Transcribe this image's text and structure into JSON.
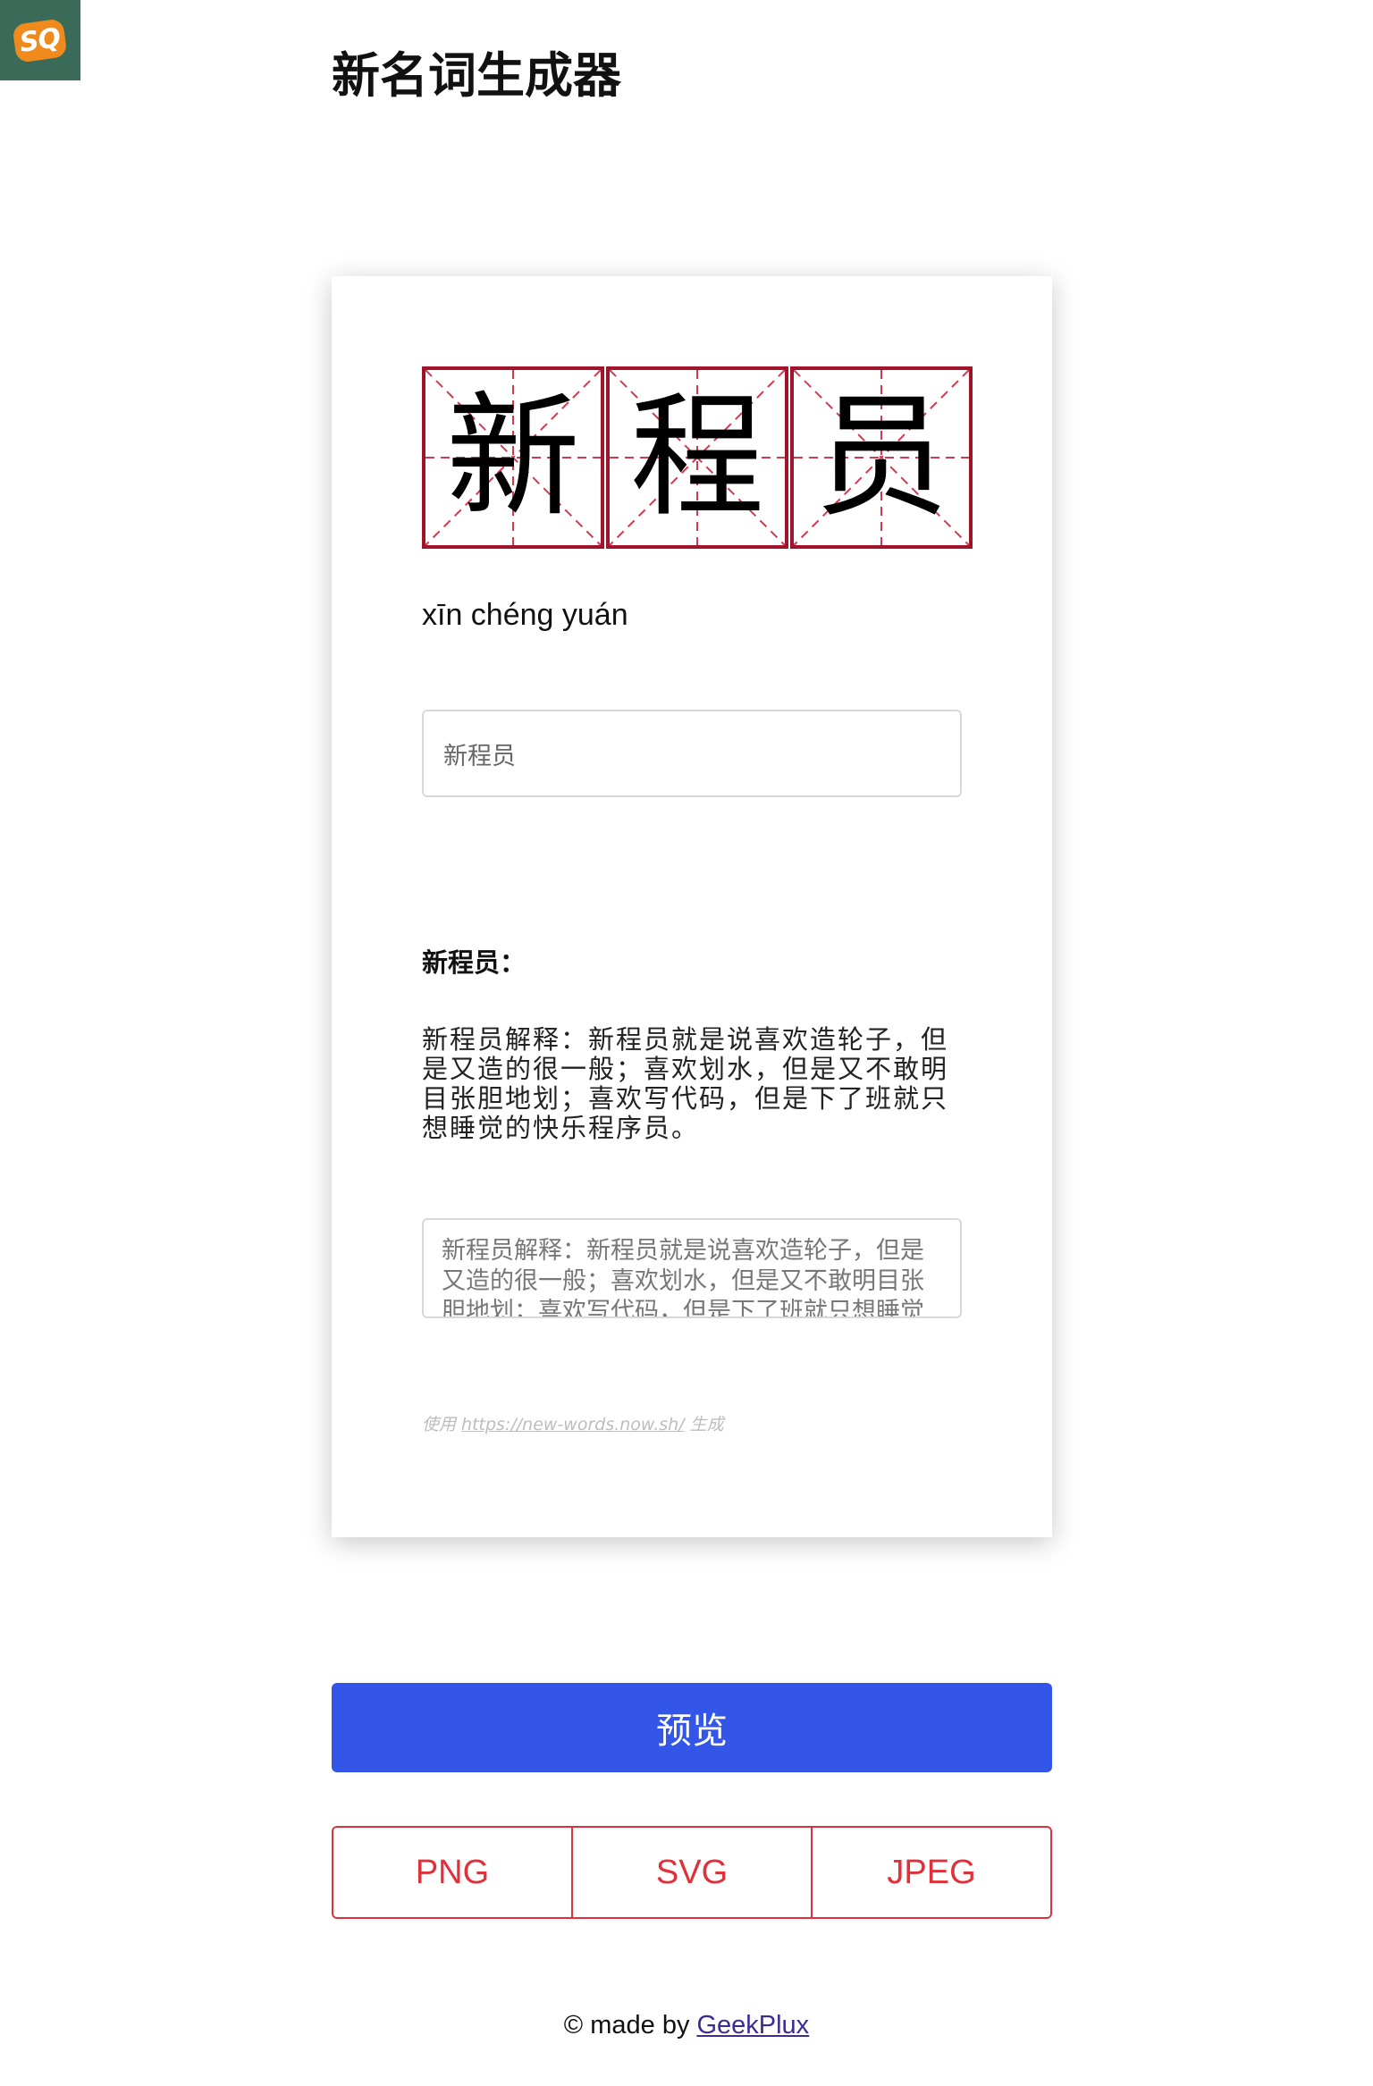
{
  "logo": {
    "text": "SQ",
    "icon": "sq-logo-icon"
  },
  "header": {
    "title": "新名词生成器"
  },
  "card": {
    "characters": [
      "新",
      "程",
      "员"
    ],
    "pinyin": "xīn chéng yuán",
    "word_input": {
      "value": "新程员"
    },
    "definition_heading": "新程员：",
    "definition_body": "新程员解释：新程员就是说喜欢造轮子，但是又造的很一般；喜欢划水，但是又不敢明目张胆地划；喜欢写代码，但是下了班就只想睡觉的快乐程序员。",
    "definition_textarea": {
      "value": "新程员解释：新程员就是说喜欢造轮子，但是又造的很一般；喜欢划水，但是又不敢明目张胆地划；喜欢写代码，但是下了班就只想睡觉的快乐程序员。"
    },
    "credit": {
      "prefix": "使用 ",
      "link": "https://new-words.now.sh/",
      "suffix": " 生成"
    }
  },
  "actions": {
    "preview_label": "预览",
    "exports": [
      "PNG",
      "SVG",
      "JPEG"
    ]
  },
  "footer": {
    "prefix": "© made by",
    "link": "GeekPlux"
  },
  "colors": {
    "grid_border": "#a0142b",
    "grid_guides": "#d23a4e",
    "primary": "#3355e8",
    "danger": "#e0303a",
    "logo_bg": "#3a6b58"
  }
}
